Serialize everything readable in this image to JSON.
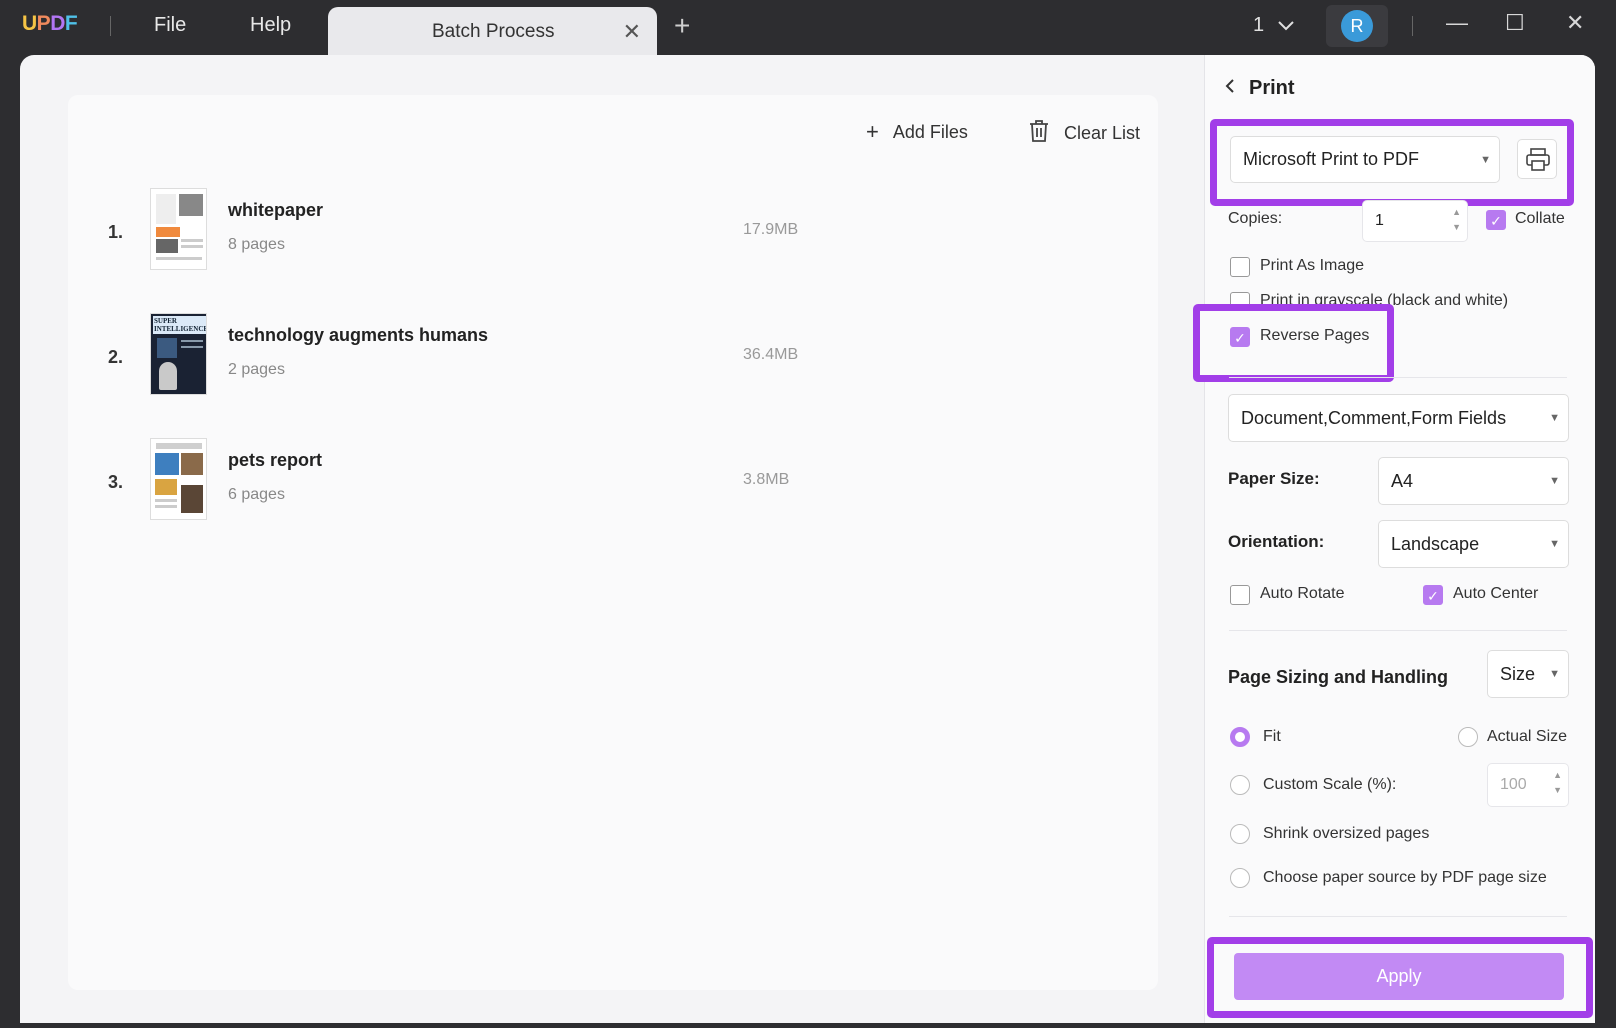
{
  "app": {
    "logo": [
      "U",
      "P",
      "D",
      "F"
    ],
    "menu": {
      "file": "File",
      "help": "Help"
    },
    "tab": {
      "title": "Batch Process",
      "close": "✕",
      "add": "+"
    },
    "page_indicator": "1",
    "avatar_initial": "R",
    "window_controls": {
      "minimize": "—",
      "maximize": "☐",
      "close": "✕"
    }
  },
  "toolbar": {
    "add_files": "Add Files",
    "clear_list": "Clear List"
  },
  "files": [
    {
      "index": "1.",
      "name": "whitepaper",
      "pages": "8 pages",
      "size": "17.9MB"
    },
    {
      "index": "2.",
      "name": "technology augments humans",
      "pages": "2 pages",
      "size": "36.4MB",
      "thumb_text": "SUPER INTELLIGENCE"
    },
    {
      "index": "3.",
      "name": "pets report",
      "pages": "6 pages",
      "size": "3.8MB"
    }
  ],
  "print_panel": {
    "title": "Print",
    "printer": "Microsoft Print to PDF",
    "copies_label": "Copies:",
    "copies_value": "1",
    "collate": {
      "label": "Collate",
      "checked": true
    },
    "print_as_image": {
      "label": "Print As Image",
      "checked": false
    },
    "grayscale": {
      "label": "Print in grayscale (black and white)",
      "checked": false
    },
    "reverse_pages": {
      "label": "Reverse Pages",
      "checked": true
    },
    "content": "Document,Comment,Form Fields",
    "paper_size_label": "Paper Size:",
    "paper_size": "A4",
    "orientation_label": "Orientation:",
    "orientation": "Landscape",
    "auto_rotate": {
      "label": "Auto Rotate",
      "checked": false
    },
    "auto_center": {
      "label": "Auto Center",
      "checked": true
    },
    "page_sizing_label": "Page Sizing and Handling",
    "page_sizing_mode": "Size",
    "fit": {
      "label": "Fit",
      "selected": true
    },
    "actual_size": {
      "label": "Actual Size",
      "selected": false
    },
    "custom_scale": {
      "label": "Custom Scale (%):",
      "selected": false,
      "value": "100"
    },
    "shrink": {
      "label": "Shrink oversized pages",
      "selected": false
    },
    "paper_source": {
      "label": "Choose paper source by PDF page size",
      "selected": false
    },
    "apply": "Apply"
  },
  "colors": {
    "accent": "#b77af0",
    "highlight": "#a23ee8",
    "avatar": "#3a9ad9"
  }
}
